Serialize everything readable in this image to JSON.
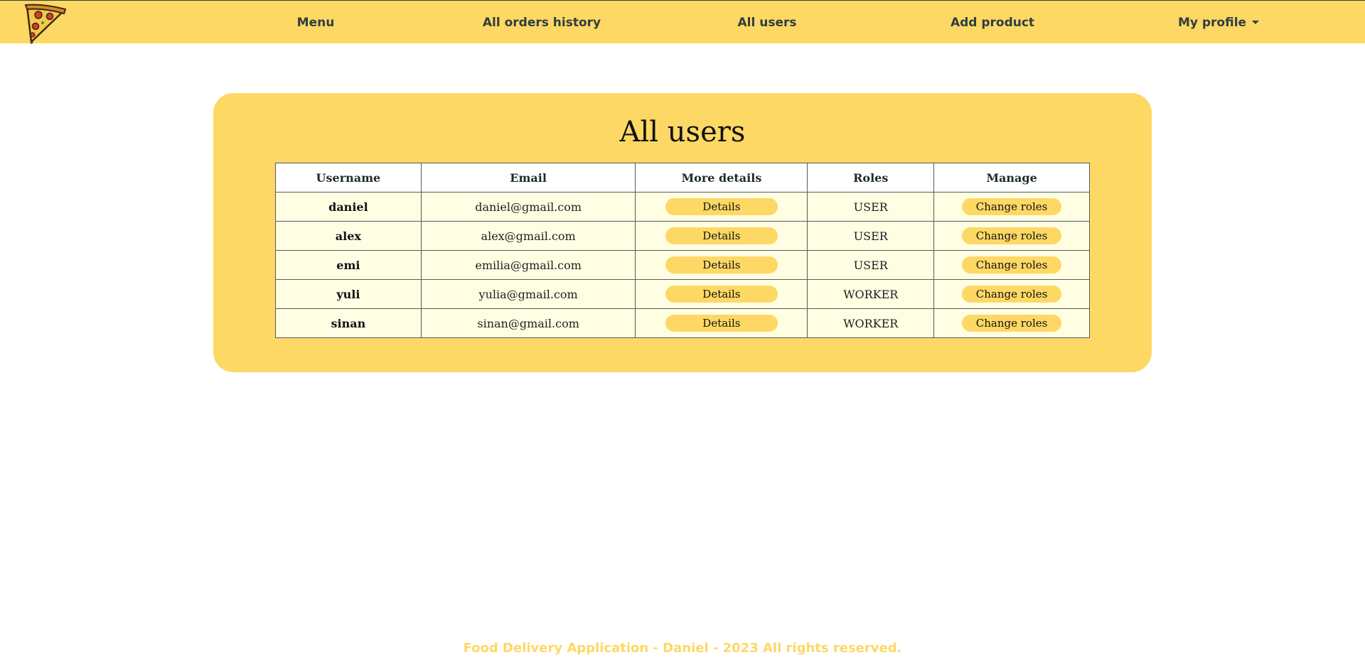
{
  "nav": {
    "logo": "pizza-slice-logo",
    "links": [
      "Menu",
      "All orders history",
      "All users",
      "Add product"
    ],
    "profile_label": "My profile"
  },
  "page": {
    "title": "All users"
  },
  "table": {
    "headers": [
      "Username",
      "Email",
      "More details",
      "Roles",
      "Manage"
    ],
    "rows": [
      {
        "username": "daniel",
        "email": "daniel@gmail.com",
        "details_label": "Details",
        "role": "USER",
        "manage_label": "Change roles"
      },
      {
        "username": "alex",
        "email": "alex@gmail.com",
        "details_label": "Details",
        "role": "USER",
        "manage_label": "Change roles"
      },
      {
        "username": "emi",
        "email": "emilia@gmail.com",
        "details_label": "Details",
        "role": "USER",
        "manage_label": "Change roles"
      },
      {
        "username": "yuli",
        "email": "yulia@gmail.com",
        "details_label": "Details",
        "role": "WORKER",
        "manage_label": "Change roles"
      },
      {
        "username": "sinan",
        "email": "sinan@gmail.com",
        "details_label": "Details",
        "role": "WORKER",
        "manage_label": "Change roles"
      }
    ]
  },
  "footer": {
    "text": "Food Delivery Application - Daniel - 2023 All rights reserved."
  },
  "colors": {
    "brand_yellow": "#fed865",
    "row_background": "#fffee3",
    "nav_text": "#2f3e3f"
  }
}
